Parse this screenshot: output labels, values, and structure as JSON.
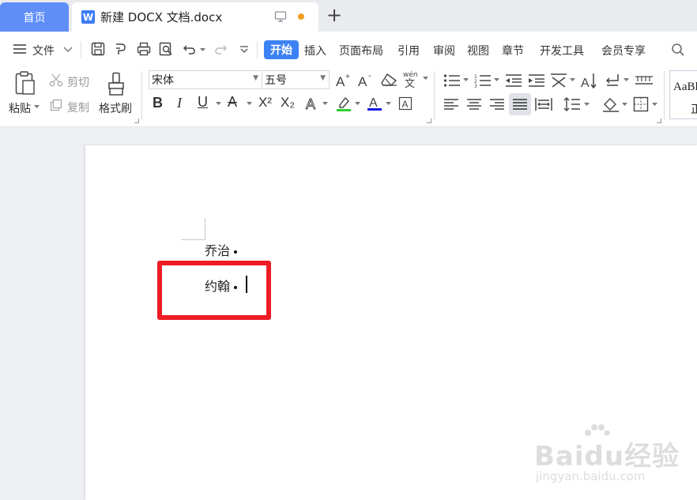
{
  "tabs": {
    "home_label": "首页",
    "doc_icon": "W",
    "doc_title": "新建 DOCX 文档.docx",
    "unsaved_color": "#f29f25"
  },
  "menu": {
    "file_label": "文件",
    "items": [
      "开始",
      "插入",
      "页面布局",
      "引用",
      "审阅",
      "视图",
      "章节",
      "开发工具",
      "会员专享"
    ],
    "accent_color": "#3d82f5"
  },
  "ribbon": {
    "paste_label": "粘贴",
    "cut_label": "剪切",
    "copy_label": "复制",
    "format_painter_label": "格式刷",
    "font_name": "宋体",
    "font_size": "五号",
    "style_preview": "AaBl",
    "style_preview_sub": "正"
  },
  "document": {
    "lines": [
      "乔治",
      "约翰"
    ]
  },
  "watermark": {
    "brand": "Baidu经验",
    "url": "jingyan.baidu.com"
  }
}
